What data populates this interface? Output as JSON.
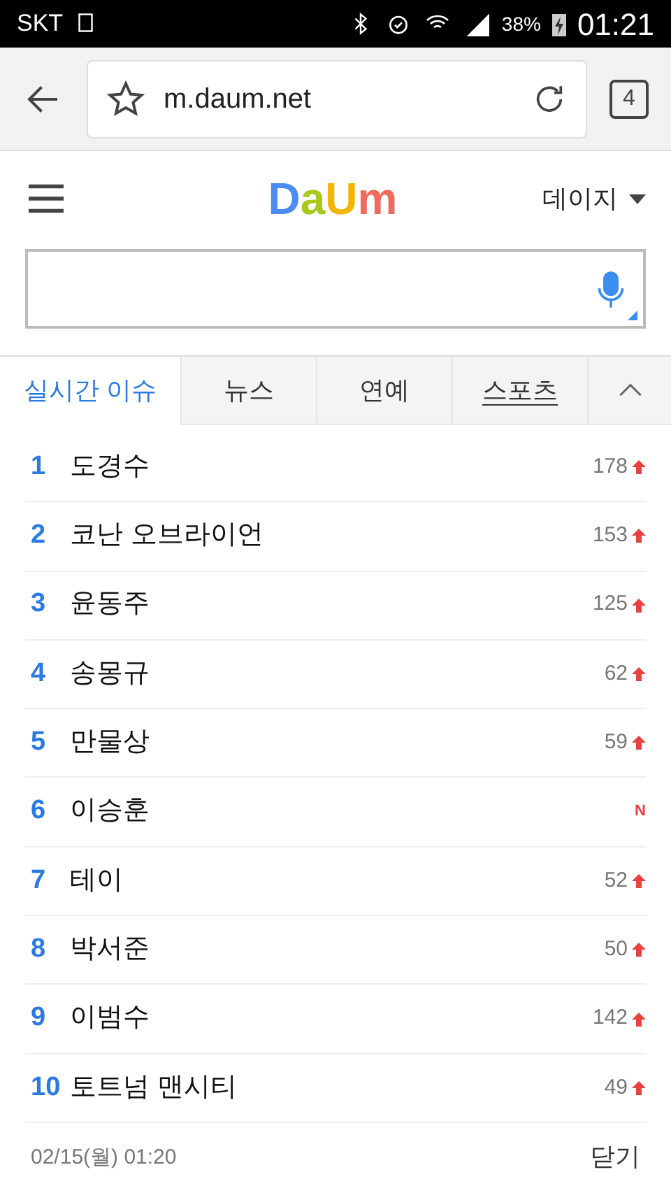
{
  "status_bar": {
    "carrier": "SKT",
    "battery": "38%",
    "time": "01:21"
  },
  "browser": {
    "url": "m.daum.net",
    "tab_count": "4"
  },
  "header": {
    "logo": [
      {
        "letter": "D",
        "color": "#4a8cf0"
      },
      {
        "letter": "a",
        "color": "#a8c81a"
      },
      {
        "letter": "U",
        "color": "#f5b400"
      },
      {
        "letter": "m",
        "color": "#f06a5e"
      }
    ],
    "account": "데이지"
  },
  "tabs": [
    {
      "label": "실시간 이슈",
      "selected": true,
      "underlined": false
    },
    {
      "label": "뉴스",
      "selected": false,
      "underlined": false
    },
    {
      "label": "연예",
      "selected": false,
      "underlined": false
    },
    {
      "label": "스포츠",
      "selected": false,
      "underlined": true
    }
  ],
  "ranking": [
    {
      "rank": "1",
      "term": "도경수",
      "kind": "up",
      "change": "178"
    },
    {
      "rank": "2",
      "term": "코난 오브라이언",
      "kind": "up",
      "change": "153"
    },
    {
      "rank": "3",
      "term": "윤동주",
      "kind": "up",
      "change": "125"
    },
    {
      "rank": "4",
      "term": "송몽규",
      "kind": "up",
      "change": "62"
    },
    {
      "rank": "5",
      "term": "만물상",
      "kind": "up",
      "change": "59"
    },
    {
      "rank": "6",
      "term": "이승훈",
      "kind": "new",
      "change": "N"
    },
    {
      "rank": "7",
      "term": "테이",
      "kind": "up",
      "change": "52"
    },
    {
      "rank": "8",
      "term": "박서준",
      "kind": "up",
      "change": "50"
    },
    {
      "rank": "9",
      "term": "이범수",
      "kind": "up",
      "change": "142"
    },
    {
      "rank": "10",
      "term": "토트넘 맨시티",
      "kind": "up",
      "change": "49"
    }
  ],
  "footer": {
    "timestamp": "02/15(월) 01:20",
    "close": "닫기"
  }
}
